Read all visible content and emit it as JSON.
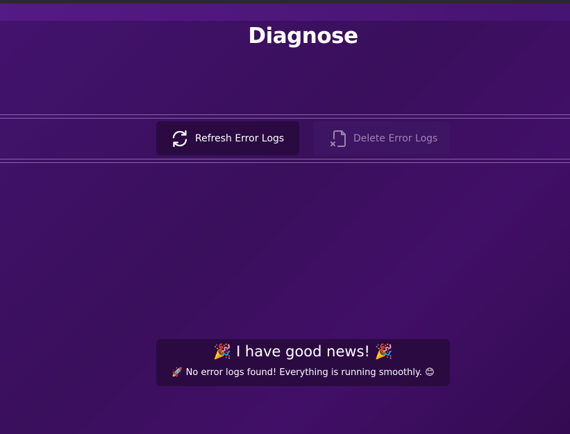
{
  "page": {
    "title": "Diagnose"
  },
  "toolbar": {
    "refresh_label": "Refresh Error Logs",
    "refresh_icon": "refresh-icon",
    "delete_label": "Delete Error Logs",
    "delete_icon": "file-delete-icon",
    "delete_disabled": true
  },
  "status": {
    "headline_emoji": "🎉",
    "headline": "I have good news!",
    "message_emoji_start": "🚀",
    "message": "No error logs found! Everything is running smoothly.",
    "message_emoji_end": "😊"
  },
  "colors": {
    "background": "#3a0f5c",
    "header_band": "#541a85",
    "primary_button": "#2a0a41",
    "disabled_button": "#3e1562",
    "disabled_text": "#9c83b3",
    "card": "#2b0a42"
  }
}
